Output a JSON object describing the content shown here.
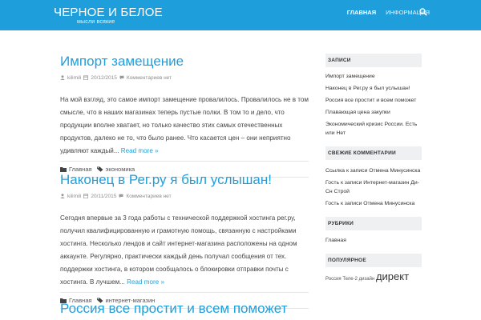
{
  "header": {
    "site_title": "ЧЕРНОЕ И БЕЛОЕ",
    "site_description": "мысли всякие",
    "nav": [
      {
        "label": "ГЛАВНАЯ"
      },
      {
        "label": "ИНФОРМАЦИЯ"
      }
    ],
    "search_icon": "search-icon",
    "bar_color": "#1e9fdc"
  },
  "posts": [
    {
      "title": "Импорт замещение",
      "author": "kilimili",
      "date": "20/12/2015",
      "comments": "Комментариев нет",
      "excerpt": "На мой взгляд, это самое импорт замещение провалилось. Провалилось не в том смысле, что в наших магазинах теперь пустые полки. В том то и дело, что продукции вполне хватает, но только качество этих самых отечественных продуктов, далеко не то, что было ранее. Что касается цен – они неприятно удивляют каждый...",
      "read_more": "Read more »",
      "category": "Главная",
      "tag": "экономика"
    },
    {
      "title": "Наконец в Рег.ру я был услышан!",
      "author": "kilimili",
      "date": "20/11/2015",
      "comments": "Комментариев нет",
      "excerpt": "Сегодня впервые за 3 года работы с технической поддержкой хостинга рег.ру, получил квалифицированную и грамотную помощь, связанную с настройками хостинга. Несколько лендов и сайт интернет-магазина расположены на одном аккаунте. Регулярно, практически каждый день получал сообщения от тех. поддержки хостинга, в котором сообщалось о блокировки отправки почты с хостинга. В лучшем...",
      "read_more": "Read more »",
      "category": "Главная",
      "tag": "интернет-магазин"
    },
    {
      "title": "Россия все простит и всем поможет"
    }
  ],
  "sidebar": {
    "recent_title": "ЗАПИСИ",
    "recent": [
      "Импорт замещение",
      "Наконец в Рег.ру я был услышан!",
      "Россия все простит и всем поможет",
      "Плавающая цена закупки",
      "Экономический кризис России. Есть или Нет"
    ],
    "comments_title": "СВЕЖИЕ КОММЕНТАРИИ",
    "comments": [
      "Ссылка к записи Отмена Минусинска",
      "Гость к записи Интернет-магазин Ди-Сн Строй",
      "Гость к записи Отмена Минусинска"
    ],
    "rubrics_title": "РУБРИКИ",
    "rubrics": [
      "Главная"
    ],
    "popular_title": "ПОПУЛЯРНОЕ",
    "popular_small": "Россия Теле-2 дизайн",
    "popular_big": "директ"
  }
}
